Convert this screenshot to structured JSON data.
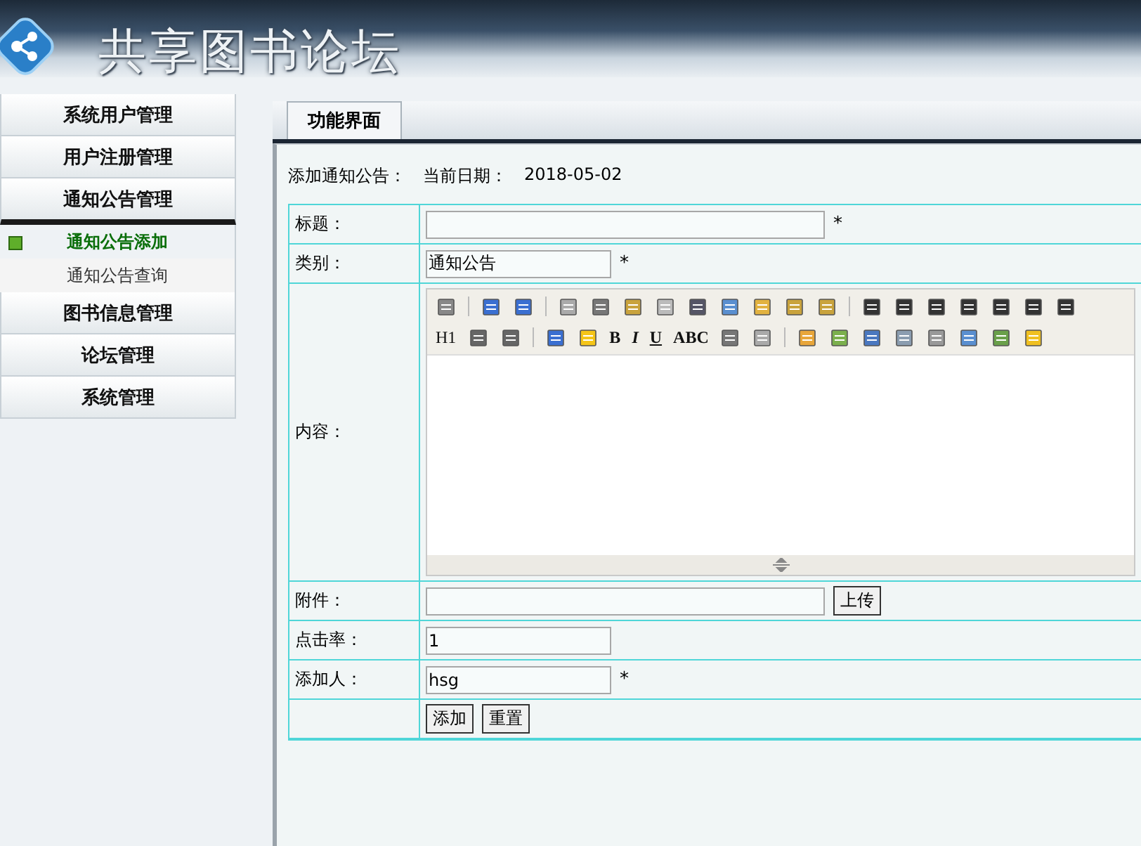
{
  "header": {
    "title": "共享图书论坛"
  },
  "sidebar": {
    "items": [
      {
        "label": "系统用户管理",
        "expanded": false
      },
      {
        "label": "用户注册管理",
        "expanded": false
      },
      {
        "label": "通知公告管理",
        "expanded": true,
        "children": [
          {
            "label": "通知公告添加",
            "selected": true
          },
          {
            "label": "通知公告查询",
            "selected": false
          }
        ]
      },
      {
        "label": "图书信息管理",
        "expanded": false
      },
      {
        "label": "论坛管理",
        "expanded": false
      },
      {
        "label": "系统管理",
        "expanded": false
      }
    ]
  },
  "tabs": [
    {
      "label": "功能界面",
      "selected": true
    }
  ],
  "form": {
    "heading": "添加通知公告：",
    "date_label": "当前日期：",
    "date": "2018-05-02",
    "fields": [
      {
        "kind": "text",
        "label": "标题：",
        "required": true,
        "wide": true
      },
      {
        "kind": "text",
        "label": "类别：",
        "value": "通知公告",
        "required": true,
        "wide": false
      },
      {
        "kind": "editor",
        "label": "内容：",
        "toolbar_text": [
          "H1",
          "B",
          "I",
          "U",
          "ABC"
        ]
      },
      {
        "kind": "upload",
        "label": "附件：",
        "button": "上传",
        "wide": true
      },
      {
        "kind": "text",
        "label": "点击率：",
        "value": "1",
        "required": false,
        "wide": false
      },
      {
        "kind": "text",
        "label": "添加人：",
        "value": "hsg",
        "required": true,
        "wide": false
      }
    ],
    "required_mark": "*",
    "buttons": [
      "添加",
      "重置"
    ]
  }
}
